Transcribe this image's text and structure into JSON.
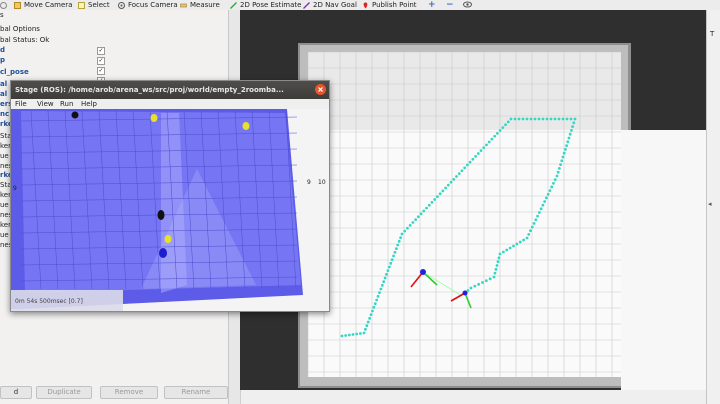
{
  "toolbar": {
    "items": [
      {
        "label": "Move Camera",
        "icon": "move-camera-icon"
      },
      {
        "label": "Select",
        "icon": "select-icon"
      },
      {
        "label": "Focus Camera",
        "icon": "focus-camera-icon"
      },
      {
        "label": "Measure",
        "icon": "measure-icon"
      },
      {
        "label": "2D Pose Estimate",
        "icon": "pose-estimate-icon"
      },
      {
        "label": "2D Nav Goal",
        "icon": "nav-goal-icon"
      },
      {
        "label": "Publish Point",
        "icon": "publish-point-icon"
      }
    ]
  },
  "left_panel": {
    "rows": [
      {
        "text": "s",
        "blue": false
      },
      {
        "text": "bal Options",
        "blue": false
      },
      {
        "text": "bal Status: Ok",
        "blue": false
      },
      {
        "text": "d",
        "blue": true
      },
      {
        "text": "p",
        "blue": true
      },
      {
        "text": "cl_pose",
        "blue": true
      },
      {
        "text": "al",
        "blue": true
      },
      {
        "text": "al",
        "blue": true
      },
      {
        "text": "ers",
        "blue": true
      },
      {
        "text": "nc",
        "blue": true
      },
      {
        "text": "rke",
        "blue": true
      },
      {
        "text": "Stat",
        "blue": false
      },
      {
        "text": "ker",
        "blue": false
      },
      {
        "text": "ue",
        "blue": false
      },
      {
        "text": "nes",
        "blue": false
      },
      {
        "text": "rke",
        "blue": true
      },
      {
        "text": "Stat",
        "blue": false
      },
      {
        "text": "ker",
        "blue": false
      },
      {
        "text": "ue",
        "blue": false
      },
      {
        "text": "nes",
        "blue": false
      },
      {
        "text": "ker",
        "blue": false
      },
      {
        "text": "ue",
        "blue": false
      },
      {
        "text": "nes",
        "blue": false
      }
    ],
    "buttons": {
      "add": "d",
      "duplicate": "Duplicate",
      "remove": "Remove",
      "rename": "Rename"
    }
  },
  "stage_window": {
    "title": "Stage (ROS): /home/arob/arena_ws/src/proj/world/empty_2roomba...",
    "menu": [
      "File",
      "View",
      "Run",
      "Help"
    ],
    "status": "0m 54s 500msec [0.7]",
    "axis_labels": {
      "left": "9",
      "right1": "9",
      "right2": "10"
    }
  },
  "right_panel": {
    "label": "T"
  },
  "colors": {
    "trajectory": "#35d6c4",
    "stage_floor": "#6f6ff2",
    "robot_blue": "#1d1dcc",
    "robot_yellow": "#e6e12a"
  }
}
